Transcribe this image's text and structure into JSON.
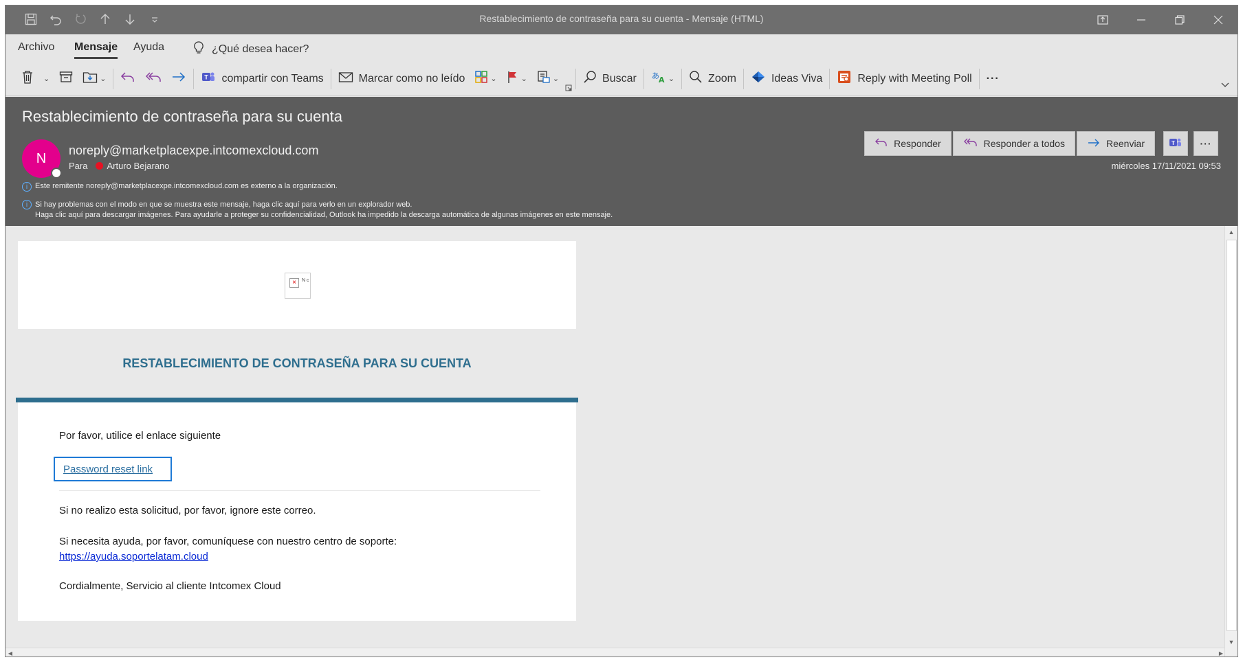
{
  "window": {
    "title": "Restablecimiento de contraseña para su cuenta  -  Mensaje (HTML)"
  },
  "menu": {
    "tabs": [
      "Archivo",
      "Mensaje",
      "Ayuda"
    ],
    "search_prompt": "¿Qué desea hacer?"
  },
  "ribbon": {
    "teams_label": "compartir con Teams",
    "mark_unread_label": "Marcar como no leído",
    "search_label": "Buscar",
    "zoom_label": "Zoom",
    "viva_label": "Ideas Viva",
    "poll_label": "Reply with Meeting Poll",
    "more_label": "···"
  },
  "message": {
    "subject": "Restablecimiento de contraseña para su cuenta",
    "avatar_initial": "N",
    "sender": "noreply@marketplacexpe.intcomexcloud.com",
    "to_label": "Para",
    "recipient": "Arturo Bejarano",
    "datetime": "miércoles 17/11/2021 09:53",
    "actions": {
      "reply": "Responder",
      "reply_all": "Responder a todos",
      "forward": "Reenviar",
      "more": "···"
    },
    "info_external": "Este remitente noreply@marketplacexpe.intcomexcloud.com es externo a la organización.",
    "info_display_1": "Si hay problemas con el modo en que se muestra este mensaje, haga clic aquí para verlo en un explorador web.",
    "info_display_2": "Haga clic aquí para descargar imágenes. Para ayudarle a proteger su confidencialidad, Outlook ha impedido la descarga automática de algunas imágenes en este mensaje."
  },
  "email": {
    "broken_image_text": "N c",
    "heading": "RESTABLECIMIENTO DE CONTRASEÑA PARA SU CUENTA",
    "intro": "Por favor, utilice el enlace siguiente",
    "reset_link": "Password reset link",
    "ignore_text": "Si no realizo esta solicitud, por favor, ignore este correo.",
    "support_text": "Si necesita ayuda, por favor, comuníquese con nuestro centro de soporte:",
    "support_url": "https://ayuda.soportelatam.cloud",
    "signature": "Cordialmente, Servicio al cliente Intcomex Cloud"
  },
  "colors": {
    "accent": "#2e6e8e",
    "avatar": "#e3008c",
    "link": "#0b2bd6"
  }
}
